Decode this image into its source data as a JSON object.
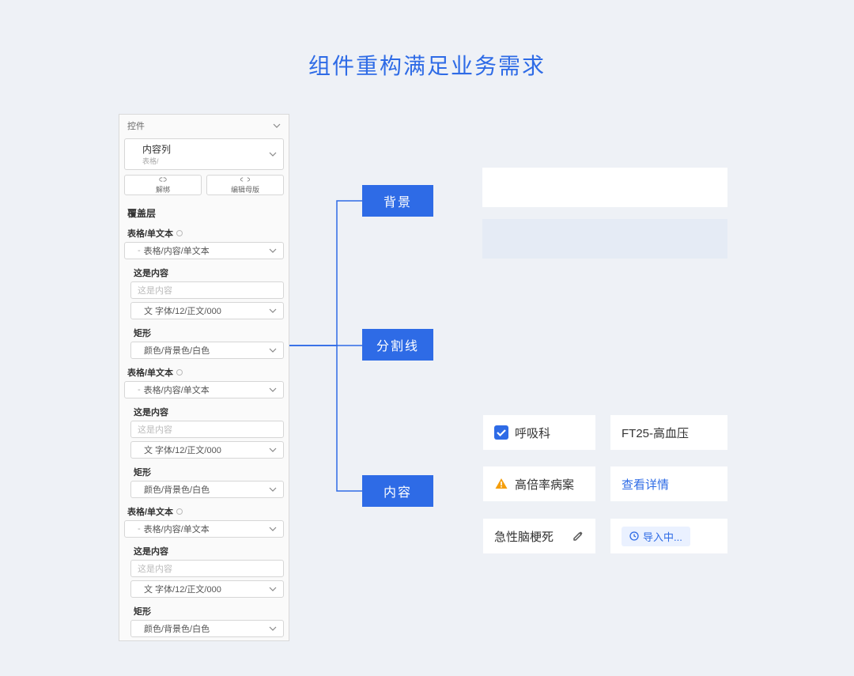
{
  "title": "组件重构满足业务需求",
  "inspector": {
    "header": "控件",
    "component": {
      "title": "内容列",
      "sub": "表格/"
    },
    "buttons": {
      "unbind": "解绑",
      "edit_master": "编辑母版"
    },
    "overlay_title": "覆盖层",
    "group_label": "表格/单文本",
    "content_label": "这是内容",
    "content_placeholder": "这是内容",
    "font_value": "文 字体/12/正文/000",
    "shape_label": "矩形",
    "color_value": "颜色/背景色/白色",
    "path_value": "表格/内容/单文本"
  },
  "center_labels": {
    "bg": "背景",
    "divider": "分割线",
    "content": "内容"
  },
  "tags": {
    "breath": "呼吸科",
    "ft25": "FT25-高血压",
    "rate": "高倍率病案",
    "detail": "查看详情",
    "brain": "急性脑梗死",
    "import": "导入中..."
  }
}
